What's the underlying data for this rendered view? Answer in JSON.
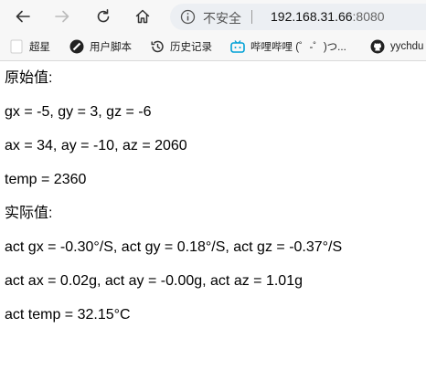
{
  "address_bar": {
    "security_label": "不安全",
    "host": "192.168.31.66",
    "port": ":8080"
  },
  "bookmarks": [
    {
      "label": "超星",
      "icon": "blank-page-icon"
    },
    {
      "label": "用户脚本",
      "icon": "tampermonkey-icon"
    },
    {
      "label": "历史记录",
      "icon": "history-icon"
    },
    {
      "label": "哔哩哔哩 (゜-゜)つ...",
      "icon": "bilibili-icon"
    },
    {
      "label": "yychdu",
      "icon": "github-icon"
    }
  ],
  "content": {
    "raw_heading": "原始值:",
    "raw_gyro": "gx = -5, gy = 3, gz = -6",
    "raw_accel": "ax = 34, ay = -10, az = 2060",
    "raw_temp": "temp = 2360",
    "actual_heading": "实际值:",
    "act_gyro": "act gx = -0.30°/S, act gy = 0.18°/S, act gz = -0.37°/S",
    "act_accel": "act ax = 0.02g, act ay = -0.00g, act az = 1.01g",
    "act_temp": "act temp = 32.15°C"
  }
}
